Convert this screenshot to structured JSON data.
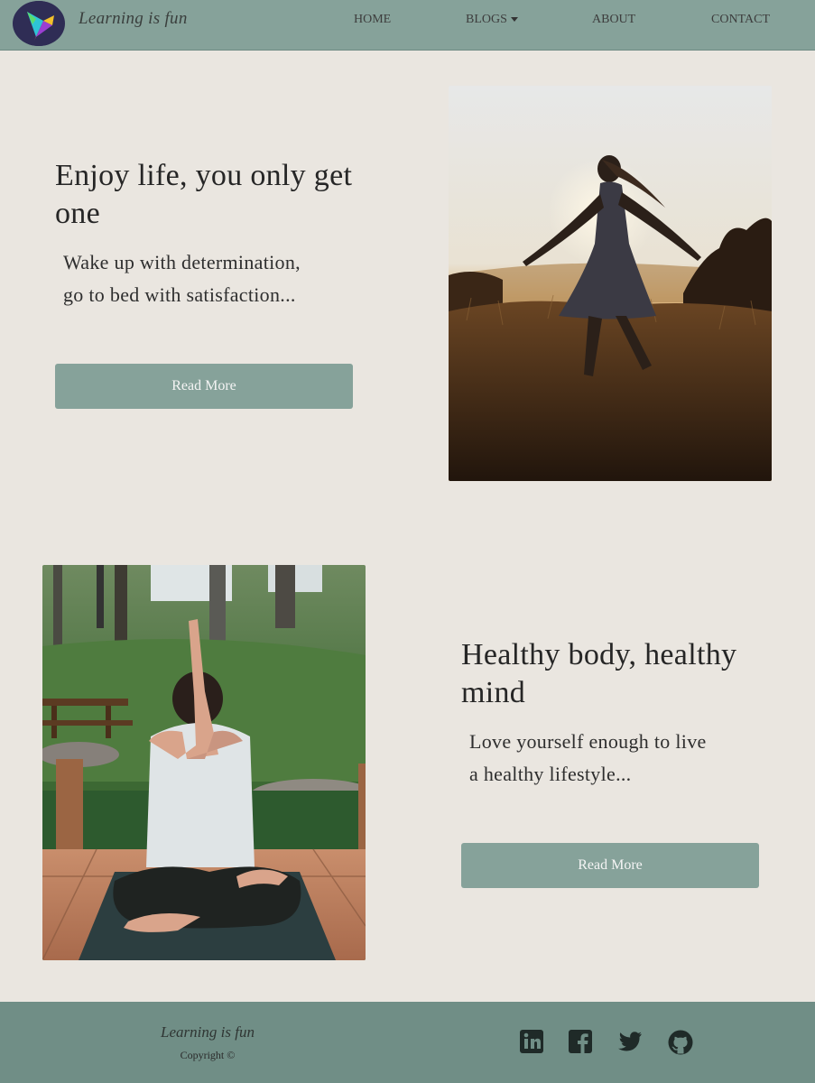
{
  "nav": {
    "brand": "Learning is fun",
    "links": [
      {
        "label": "HOME"
      },
      {
        "label": "BLOGS"
      },
      {
        "label": "ABOUT"
      },
      {
        "label": "CONTACT"
      }
    ]
  },
  "sections": [
    {
      "heading": "Enjoy life, you only get one",
      "subtitle_line1": "Wake up with determination,",
      "subtitle_line2": "go to bed with satisfaction...",
      "button": "Read More",
      "image": "woman-dancing-at-sunset"
    },
    {
      "heading": "Healthy body, healthy mind",
      "subtitle_line1": "Love yourself enough to live",
      "subtitle_line2": "a healthy lifestyle...",
      "button": "Read More",
      "image": "woman-doing-yoga-outdoors"
    }
  ],
  "footer": {
    "brand": "Learning is fun",
    "copyright": "Copyright ©",
    "social": [
      "linkedin-icon",
      "facebook-icon",
      "twitter-icon",
      "github-icon"
    ]
  },
  "colors": {
    "nav": "#86a29a",
    "background": "#eae6e0",
    "button": "#86a29a",
    "footer": "#708e86"
  }
}
